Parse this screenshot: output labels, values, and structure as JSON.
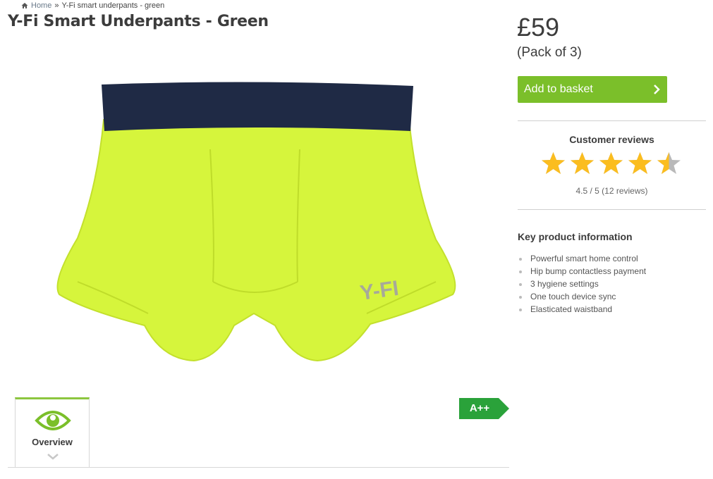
{
  "breadcrumb": {
    "home": "Home",
    "separator": "»",
    "current": "Y-Fi smart underpants - green",
    "icon": "home-icon"
  },
  "product": {
    "title": "Y-Fi Smart Underpants - Green",
    "image_brand_text": "Y-FI",
    "energy_rating": "A++",
    "tabs": [
      {
        "label": "Overview",
        "icon": "eye-icon"
      }
    ]
  },
  "buy": {
    "price": "£59",
    "pack": "(Pack of 3)",
    "add_label": "Add to basket"
  },
  "reviews": {
    "title": "Customer reviews",
    "rating": 4.5,
    "max": 5,
    "summary": "4.5 / 5 (12 reviews)"
  },
  "info": {
    "title": "Key product information",
    "features": [
      "Powerful smart home control",
      "Hip bump contactless payment",
      "3 hygiene settings",
      "One touch device sync",
      "Elasticated waistband"
    ]
  },
  "colors": {
    "accent": "#7bbf2a",
    "energy": "#2aa23a",
    "star": "#fbbd1f",
    "underpants": "#d6f53c",
    "waistband": "#1f2a45"
  }
}
